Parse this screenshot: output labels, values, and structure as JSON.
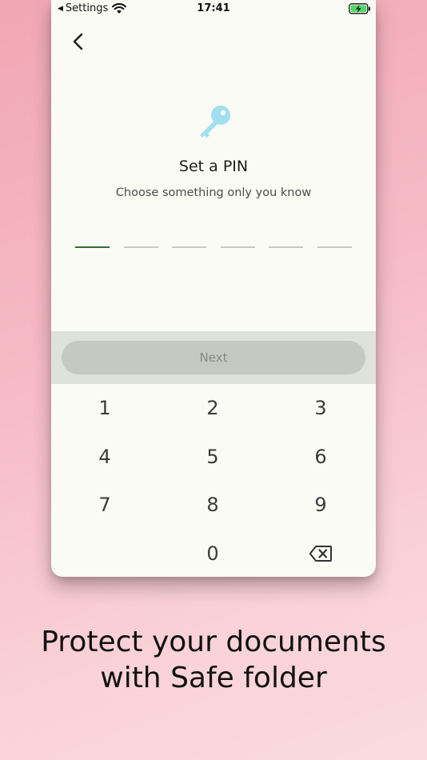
{
  "status_bar": {
    "back_label": "Settings",
    "time": "17:41"
  },
  "screen": {
    "title": "Set a PIN",
    "subtitle": "Choose something only you know",
    "next_label": "Next",
    "pin_length": 6,
    "pin_filled": 0
  },
  "keypad": {
    "keys": [
      "1",
      "2",
      "3",
      "4",
      "5",
      "6",
      "7",
      "8",
      "9",
      "0"
    ]
  },
  "caption": {
    "line1": "Protect your documents",
    "line2": "with Safe folder"
  },
  "colors": {
    "accent": "#3a6a2e",
    "key_icon": "#9fdff0",
    "next_button": "#c5c9c0",
    "background_top": "#f1a7b4",
    "background_bottom": "#fbdade"
  }
}
